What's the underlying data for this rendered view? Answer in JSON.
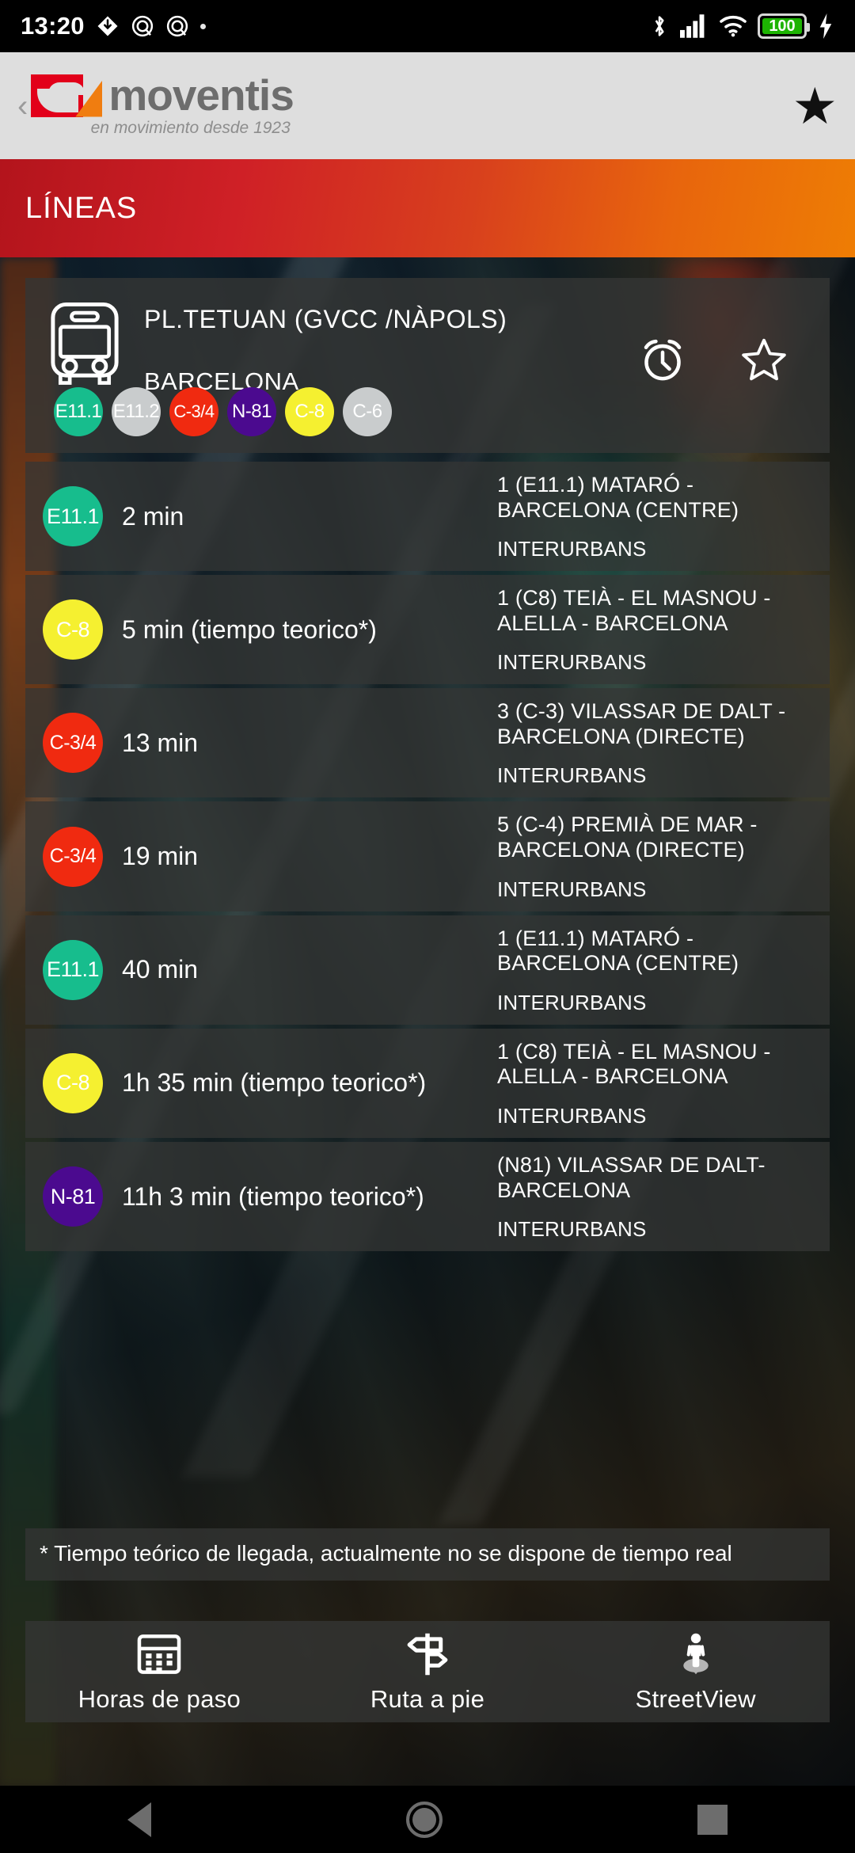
{
  "statusbar": {
    "time": "13:20",
    "icons": [
      "sync-download-icon",
      "do-not-disturb-icon",
      "do-not-disturb-icon",
      "dot-icon"
    ],
    "right_icons": [
      "bluetooth-icon",
      "signal-bars-icon",
      "wifi-icon",
      "battery-icon",
      "charging-bolt-icon"
    ],
    "battery_level": "100"
  },
  "brand": {
    "back_label": "‹",
    "name": "moventis",
    "tagline": "en movimiento desde 1923",
    "favorite_icon": "star-filled-icon",
    "logo_red": "#e2001a",
    "logo_orange": "#f07d10",
    "logo_gray": "#6d6d6d"
  },
  "header": {
    "title": "LÍNEAS",
    "gradient_from": "#b3141c",
    "gradient_to": "#ee7d04"
  },
  "stop": {
    "icon": "bus-icon",
    "name": "PL.TETUAN (GVCC /NÀPOLS)",
    "city": "BARCELONA",
    "alarm_icon": "alarm-clock-icon",
    "favorite_icon": "star-outline-icon",
    "lines": [
      {
        "label": "E11.1",
        "color": "#17bd8d",
        "text_color": "#ffffff"
      },
      {
        "label": "E11.2",
        "color": "#c9cccd",
        "text_color": "#ffffff"
      },
      {
        "label": "C-3/4",
        "color": "#f02a10",
        "text_color": "#ffffff"
      },
      {
        "label": "N-81",
        "color": "#4b0a8f",
        "text_color": "#ffffff"
      },
      {
        "label": "C-8",
        "color": "#f5f030",
        "text_color": "#ffffff"
      },
      {
        "label": "C-6",
        "color": "#c9cccd",
        "text_color": "#ffffff"
      }
    ]
  },
  "arrivals": [
    {
      "line": "E11.1",
      "color": "#17bd8d",
      "text_color": "#ffffff",
      "time": "2 min",
      "destination": "1 (E11.1) MATARÓ - BARCELONA  (CENTRE)",
      "type": "INTERURBANS"
    },
    {
      "line": "C-8",
      "color": "#f5f030",
      "text_color": "#ffffff",
      "time": "5 min (tiempo teorico*)",
      "destination": "1  (C8) TEIÀ - EL MASNOU - ALELLA  - BARCELONA",
      "type": "INTERURBANS"
    },
    {
      "line": "C-3/4",
      "color": "#f02a10",
      "text_color": "#ffffff",
      "time": "13 min",
      "destination": "3 (C-3) VILASSAR DE DALT - BARCELONA (DIRECTE)",
      "type": "INTERURBANS"
    },
    {
      "line": "C-3/4",
      "color": "#f02a10",
      "text_color": "#ffffff",
      "time": "19 min",
      "destination": "5 (C-4) PREMIÀ DE MAR - BARCELONA (DIRECTE)",
      "type": "INTERURBANS"
    },
    {
      "line": "E11.1",
      "color": "#17bd8d",
      "text_color": "#ffffff",
      "time": "40 min",
      "destination": "1 (E11.1) MATARÓ - BARCELONA  (CENTRE)",
      "type": "INTERURBANS"
    },
    {
      "line": "C-8",
      "color": "#f5f030",
      "text_color": "#ffffff",
      "time": "1h 35 min (tiempo teorico*)",
      "destination": "1  (C8) TEIÀ - EL MASNOU - ALELLA  - BARCELONA",
      "type": "INTERURBANS"
    },
    {
      "line": "N-81",
      "color": "#4b0a8f",
      "text_color": "#ffffff",
      "time": "11h 3 min (tiempo teorico*)",
      "destination": "(N81) VILASSAR DE DALT-BARCELONA",
      "type": "INTERURBANS"
    }
  ],
  "footnote": "* Tiempo teórico de llegada, actualmente no se dispone de tiempo real",
  "actions": [
    {
      "label": "Horas de paso",
      "icon": "calendar-icon"
    },
    {
      "label": "Ruta a pie",
      "icon": "signpost-icon"
    },
    {
      "label": "StreetView",
      "icon": "pegman-icon"
    }
  ],
  "navbar": {
    "back": "back-triangle-icon",
    "home": "home-circle-icon",
    "recents": "recents-square-icon"
  }
}
